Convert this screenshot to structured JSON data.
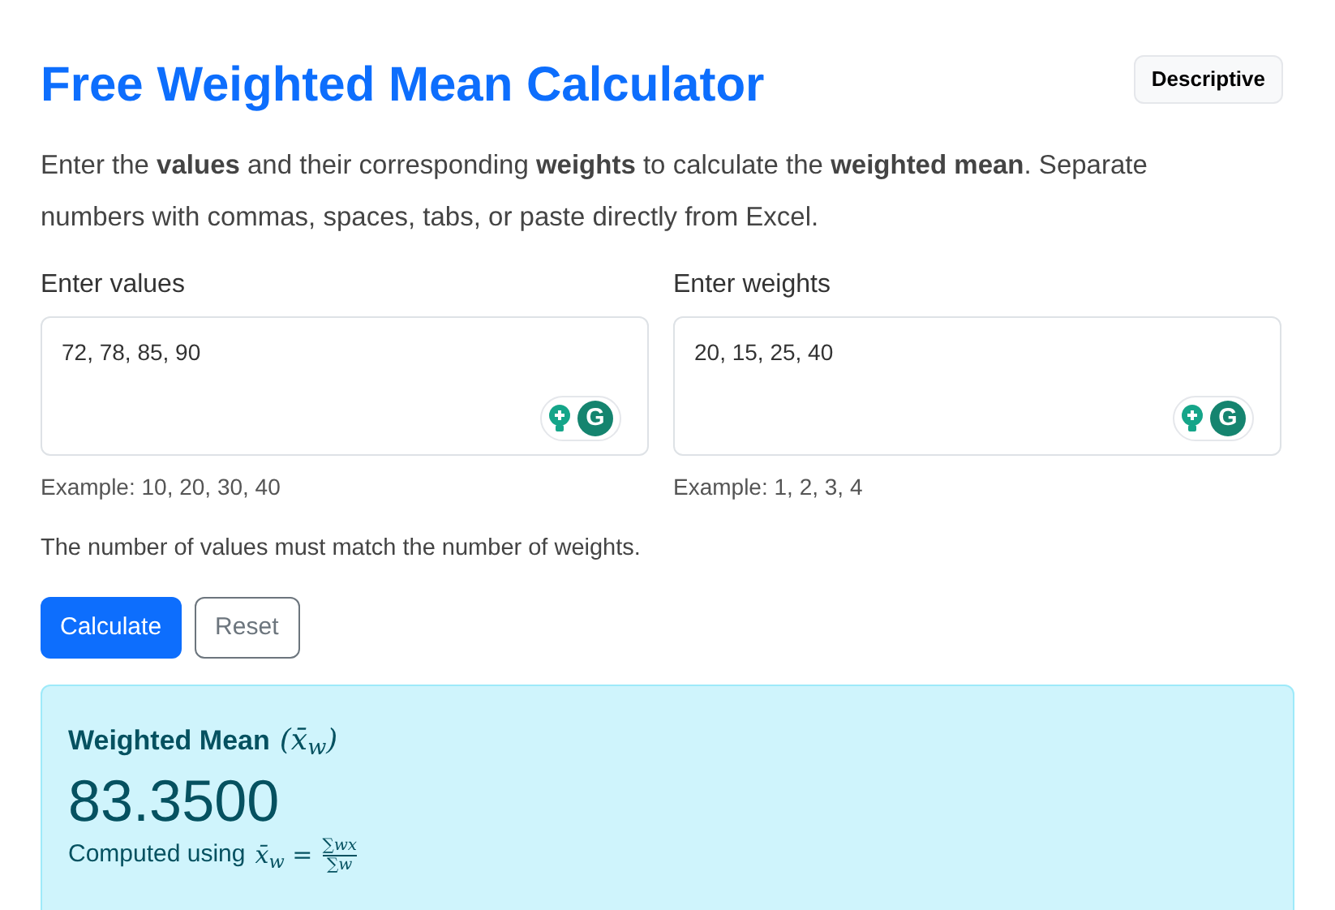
{
  "title": "Free Weighted Mean Calculator",
  "badge": "Descriptive",
  "description": "Enter the **values** and their corresponding **weights** to calculate the **weighted mean**. Separate numbers with commas, spaces, tabs, or paste directly from Excel.",
  "fields": [
    {
      "label": "Enter values",
      "value": "72, 78, 85, 90",
      "badge_letter": "G",
      "example": "Example: 10, 20, 30, 40"
    },
    {
      "label": "Enter weights",
      "value": "20, 15, 25, 40",
      "badge_letter": "G",
      "example": "Example: 1, 2, 3, 4"
    }
  ],
  "note": "The number of values must match the number of weights.",
  "buttons": [
    {
      "label": "Calculate",
      "kind": "primary"
    },
    {
      "label": "Reset",
      "kind": "secondary"
    }
  ],
  "result": {
    "heading": "Weighted Mean",
    "symbol": "(x̄$_{w}$)",
    "value": "83.3500",
    "formula_prefix": "Computed using",
    "formula_lhs": "x̄$_{w}$ =",
    "numerator": "∑wx",
    "denominator": "∑w"
  }
}
